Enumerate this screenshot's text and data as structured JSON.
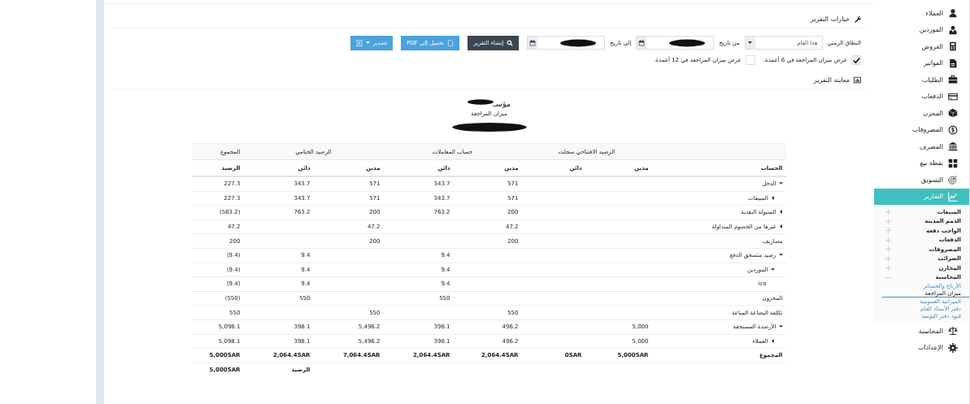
{
  "options": {
    "title": "خيارات التقرير",
    "range": {
      "label": "النطاق الزمني",
      "value": "هذا العام"
    },
    "from": {
      "label": "من تاريخ"
    },
    "to": {
      "label": "إلى تاريخ"
    },
    "buttons": [
      {
        "label": "إنشاء التقرير",
        "kind": "dark"
      },
      {
        "label": "تحميل إلى PDF",
        "kind": "pdf"
      },
      {
        "label": "تصدير",
        "kind": "export"
      }
    ],
    "checkboxes": [
      {
        "label": "عرض ميزان المراجعة في 6 أعمدة.",
        "checked": true
      },
      {
        "label": "عرض ميزان المراجعة في 12 أعمدة.",
        "checked": false
      }
    ]
  },
  "preview": {
    "title": "معاينة التقرير",
    "company": "مؤسـ",
    "report_name": "ميزان المراجعة"
  },
  "table": {
    "groups": [
      "الرصيد الافتتاحي سجلت",
      "حساب المعاملات",
      "الرصيد الختامي",
      "المجموع"
    ],
    "columns": [
      "الحساب",
      "مدين",
      "دائن",
      "مدين",
      "دائن",
      "مدين",
      "دائن",
      "الرصيد"
    ],
    "rows": [
      {
        "account": "الدخل",
        "expanded": true,
        "cells": {
          "tx_debit": "571",
          "tx_credit": "343.7",
          "closing_debit": "571",
          "closing_credit": "343.7",
          "balance": "227.3"
        },
        "children": [
          {
            "account": "المبيعات",
            "expanded": false,
            "cells": {
              "tx_debit": "571",
              "tx_credit": "343.7",
              "closing_debit": "571",
              "closing_credit": "343.7",
              "balance": "227.3"
            }
          }
        ]
      },
      {
        "account": "السيولة النقدية",
        "expanded": false,
        "cells": {
          "tx_debit": "200",
          "tx_credit": "763.2",
          "closing_debit": "200",
          "closing_credit": "763.2",
          "balance": "(563.2)"
        }
      },
      {
        "account": "غيرها من الخصوم المتداولة",
        "expanded": false,
        "cells": {
          "tx_debit": "47.2",
          "closing_debit": "47.2",
          "balance": "47.2"
        }
      },
      {
        "account": "مصاريف",
        "cells": {
          "tx_debit": "200",
          "closing_debit": "200",
          "balance": "200"
        }
      },
      {
        "account": "رصيد متسحق الدفع",
        "expanded": true,
        "cells": {
          "tx_credit": "9.4",
          "closing_credit": "9.4",
          "balance": "(9.4)"
        },
        "children": [
          {
            "account": "الموردين",
            "expanded": true,
            "cells": {
              "tx_credit": "9.4",
              "closing_credit": "9.4",
              "balance": "(9.4)"
            },
            "children": [
              {
                "account": "ico",
                "cells": {
                  "tx_credit": "9.4",
                  "closing_credit": "9.4",
                  "balance": "(9.4)"
                }
              }
            ]
          }
        ]
      },
      {
        "account": "المخزون",
        "cells": {
          "tx_credit": "550",
          "closing_credit": "550",
          "balance": "(550)"
        }
      },
      {
        "account": "تكلفة البضاعة المباعة",
        "cells": {
          "tx_debit": "550",
          "closing_debit": "550",
          "balance": "550"
        }
      },
      {
        "account": "الأرصدة المستحقة",
        "expanded": true,
        "cells": {
          "opening_debit": "5,000",
          "tx_debit": "496.2",
          "tx_credit": "398.1",
          "closing_debit": "5,496.2",
          "closing_credit": "398.1",
          "balance": "5,098.1"
        },
        "children": [
          {
            "account": "العملاء",
            "expanded": false,
            "cells": {
              "opening_debit": "5,000",
              "tx_debit": "496.2",
              "tx_credit": "398.1",
              "closing_debit": "5,496.2",
              "closing_credit": "398.1",
              "balance": "5,098.1"
            }
          }
        ]
      }
    ],
    "total": {
      "label": "المجموع",
      "cells": {
        "opening_debit": "5,000SAR",
        "opening_credit": "0SAR",
        "tx_debit": "2,064.4SAR",
        "tx_credit": "2,064.4SAR",
        "closing_debit": "7,064.4SAR",
        "closing_credit": "2,064.4SAR",
        "balance": "5,000SAR"
      }
    },
    "balance": {
      "label": "الرصيد",
      "value": "5,000SAR"
    }
  },
  "sidebar": {
    "items": [
      {
        "label": "العملاء",
        "selected": false
      },
      {
        "label": "الموردين",
        "selected": false
      },
      {
        "label": "العروض",
        "selected": false
      },
      {
        "label": "الفواتير",
        "selected": false
      },
      {
        "label": "الطلبات",
        "selected": false
      },
      {
        "label": "الدفعات",
        "selected": false
      },
      {
        "label": "المخزن",
        "selected": false
      },
      {
        "label": "المصروفات",
        "selected": false
      },
      {
        "label": "المصرف",
        "selected": false
      },
      {
        "label": "نقطة بيع",
        "selected": false
      },
      {
        "label": "التسويق",
        "selected": false
      },
      {
        "label": "التقارير",
        "selected": true,
        "children": [
          {
            "label": "المبيعات",
            "expanded": false
          },
          {
            "label": "الذمم المدينة",
            "expanded": false
          },
          {
            "label": "الواجب دفعه",
            "expanded": false
          },
          {
            "label": "الدفعات",
            "expanded": false
          },
          {
            "label": "المصروفات",
            "expanded": false
          },
          {
            "label": "الضرائب",
            "expanded": false
          },
          {
            "label": "المخازن",
            "expanded": false
          },
          {
            "label": "المحاسبة",
            "expanded": true,
            "children": [
              {
                "label": "الأرباح والخسائر",
                "selected": false
              },
              {
                "label": "ميزان المراجعة",
                "selected": true
              },
              {
                "label": "الميزانية العمومية",
                "selected": false
              },
              {
                "label": "دفتر الأستاذ العام",
                "selected": false
              },
              {
                "label": "قيود دفتر اليومية",
                "selected": false
              }
            ]
          }
        ]
      },
      {
        "label": "المحاسبة",
        "selected": false
      },
      {
        "label": "الإعدادات",
        "selected": false
      }
    ]
  }
}
